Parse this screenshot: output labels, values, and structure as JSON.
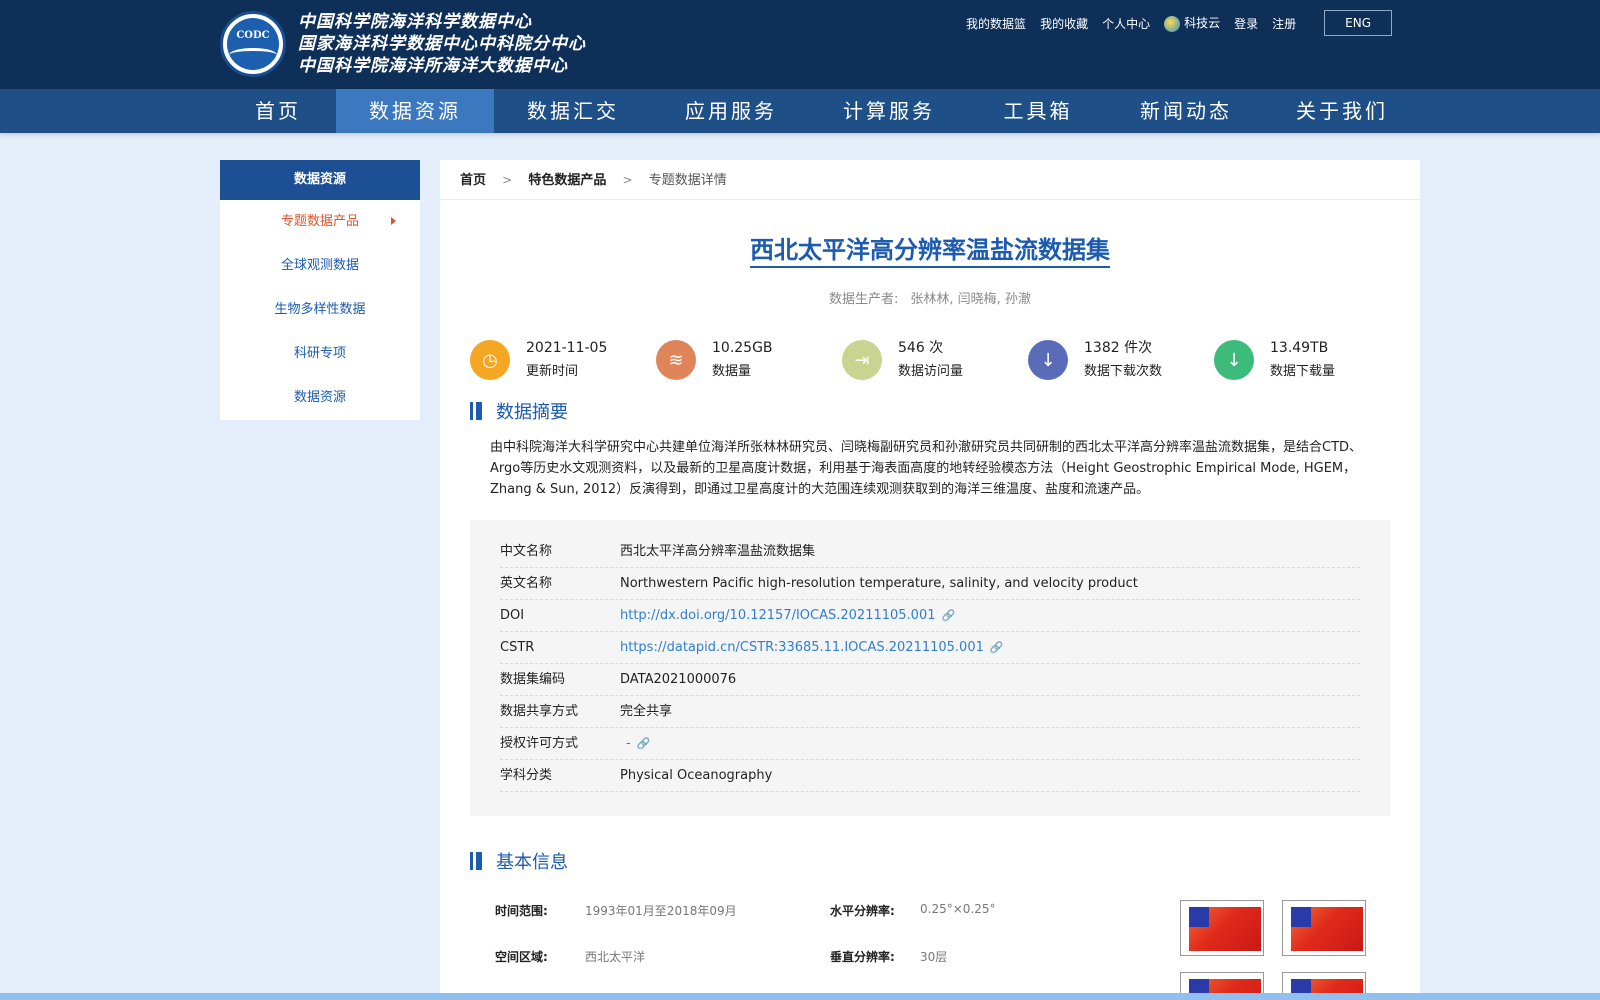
{
  "header": {
    "logo_badge": "CODC",
    "logo_lines": [
      "中国科学院海洋科学数据中心",
      "国家海洋科学数据中心中科院分中心",
      "中国科学院海洋所海洋大数据中心"
    ],
    "top_links": [
      "我的数据篮",
      "我的收藏",
      "个人中心",
      "科技云",
      "登录",
      "注册"
    ],
    "lang_button": "ENG"
  },
  "nav": {
    "items": [
      "首页",
      "数据资源",
      "数据汇交",
      "应用服务",
      "计算服务",
      "工具箱",
      "新闻动态",
      "关于我们"
    ],
    "active_index": 1
  },
  "sidebar": {
    "title": "数据资源",
    "items": [
      "专题数据产品",
      "全球观测数据",
      "生物多样性数据",
      "科研专项",
      "数据资源"
    ],
    "active_index": 0
  },
  "breadcrumb": [
    "首页",
    "特色数据产品",
    "专题数据详情"
  ],
  "dataset": {
    "title": "西北太平洋高分辨率温盐流数据集",
    "producer_label": "数据生产者:",
    "producers": "张林林, 闫晓梅, 孙澈"
  },
  "stats": [
    {
      "value": "2021-11-05",
      "label": "更新时间",
      "icon": "clock-icon",
      "color": "#f5a623"
    },
    {
      "value": "10.25GB",
      "label": "数据量",
      "icon": "layers-icon",
      "color": "#e0845a"
    },
    {
      "value": "546 次",
      "label": "数据访问量",
      "icon": "enter-icon",
      "color": "#c8d48f"
    },
    {
      "value": "1382 件次",
      "label": "数据下载次数",
      "icon": "download-icon",
      "color": "#5a6bb8"
    },
    {
      "value": "13.49TB",
      "label": "数据下载量",
      "icon": "download-icon",
      "color": "#3dbb7a"
    }
  ],
  "abstract": {
    "heading": "数据摘要",
    "text": "由中科院海洋大科学研究中心共建单位海洋所张林林研究员、闫晓梅副研究员和孙澈研究员共同研制的西北太平洋高分辨率温盐流数据集，是结合CTD、Argo等历史水文观测资料，以及最新的卫星高度计数据，利用基于海表面高度的地转经验模态方法（Height Geostrophic Empirical Mode, HGEM，Zhang & Sun, 2012）反演得到，即通过卫星高度计的大范围连续观测获取到的海洋三维温度、盐度和流速产品。"
  },
  "metadata": [
    {
      "key": "中文名称",
      "value": "西北太平洋高分辨率温盐流数据集",
      "link": false
    },
    {
      "key": "英文名称",
      "value": "Northwestern Pacific high-resolution temperature, salinity, and velocity product",
      "link": false
    },
    {
      "key": "DOI",
      "value": "http://dx.doi.org/10.12157/IOCAS.20211105.001",
      "link": true
    },
    {
      "key": "CSTR",
      "value": "https://datapid.cn/CSTR:33685.11.IOCAS.20211105.001",
      "link": true
    },
    {
      "key": "数据集编码",
      "value": "DATA2021000076",
      "link": false
    },
    {
      "key": "数据共享方式",
      "value": "完全共享",
      "link": false
    },
    {
      "key": "授权许可方式",
      "value": "-",
      "link": true
    },
    {
      "key": "学科分类",
      "value": "Physical Oceanography",
      "link": false
    }
  ],
  "basic_info": {
    "heading": "基本信息",
    "time_range_label": "时间范围:",
    "time_range": "1993年01月至2018年09月",
    "h_res_label": "水平分辨率:",
    "h_res": "0.25°×0.25°",
    "region_label": "空间区域:",
    "region": "西北太平洋",
    "v_res_label": "垂直分辨率:",
    "v_res": "30层"
  }
}
